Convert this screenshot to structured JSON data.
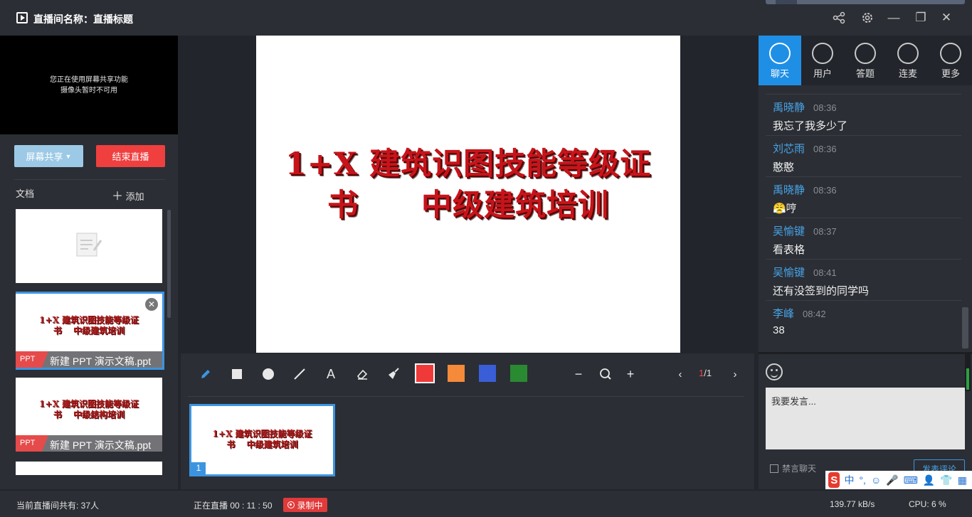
{
  "titlebar": {
    "title": "直播间名称：直播标题",
    "share_icon": "share-icon",
    "settings_icon": "gear-icon",
    "minimize": "—",
    "restore": "❐",
    "close": "✕"
  },
  "left": {
    "camera_msg_1": "您正在使用屏幕共享功能",
    "camera_msg_2": "摄像头暂时不可用",
    "share_label": "屏幕共享",
    "end_label": "结束直播",
    "docs_label": "文档",
    "add_label": "添加",
    "docs": [
      {
        "tag": "",
        "name": ""
      },
      {
        "tag": "PPT",
        "name": "新建 PPT 演示文稿.ppt",
        "line1": "1+X 建筑识图技能等级证",
        "line2": "书　 中级建筑培训"
      },
      {
        "tag": "PPT",
        "name": "新建 PPT 演示文稿.ppt",
        "line1": "1+X 建筑识图技能等级证",
        "line2": "书　 中级结构培训"
      }
    ]
  },
  "slide": {
    "line1": "1+X 建筑识图技能等级证",
    "line2": "书　　中级建筑培训"
  },
  "toolbar": {
    "colors": [
      "#f03a3a",
      "#f48a3a",
      "#3a5ed8",
      "#2a8a32"
    ],
    "page_current": "1",
    "page_total": "/1",
    "thumb_number": "1",
    "thumb_line1": "1+X 建筑识图技能等级证",
    "thumb_line2": "书　 中级建筑培训"
  },
  "tabs": [
    "聊天",
    "用户",
    "答题",
    "连麦",
    "更多"
  ],
  "chat": [
    {
      "name": "禹晓静",
      "time": "08:36",
      "text": "我忘了我多少了"
    },
    {
      "name": "刘芯雨",
      "time": "08:36",
      "text": "憨憨"
    },
    {
      "name": "禹晓静",
      "time": "08:36",
      "text": "😤哼"
    },
    {
      "name": "吴愉键",
      "time": "08:37",
      "text": "看表格"
    },
    {
      "name": "吴愉键",
      "time": "08:41",
      "text": "还有没签到的同学吗"
    },
    {
      "name": "李峰",
      "time": "08:42",
      "text": "38"
    }
  ],
  "comment": {
    "placeholder": "我要发言...",
    "mute_label": "禁言聊天",
    "send_label": "发表评论"
  },
  "ime": {
    "logo": "S",
    "lang": "中",
    "punct": "°,"
  },
  "status": {
    "viewers": "当前直播间共有: 37人",
    "live_time": "正在直播 00 : 11 : 50",
    "recording": "录制中",
    "network": "139.77 kB/s",
    "cpu": "CPU:   6 %"
  }
}
